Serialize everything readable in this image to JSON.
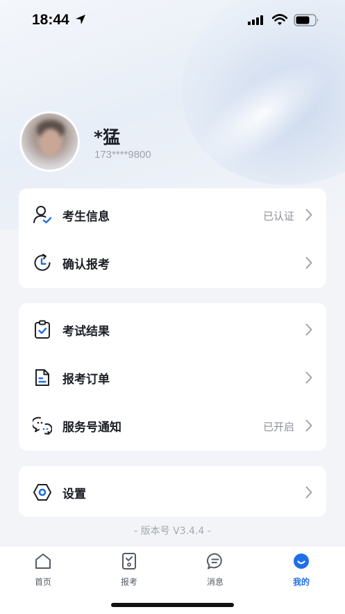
{
  "status_bar": {
    "time": "18:44",
    "icons": [
      "location-arrow-icon",
      "cellular-signal-icon",
      "wifi-icon",
      "battery-icon"
    ]
  },
  "profile": {
    "name": "*猛",
    "phone": "173****9800"
  },
  "groups": [
    {
      "items": [
        {
          "label": "考生信息",
          "status": "已认证",
          "icon": "user-check-icon"
        },
        {
          "label": "确认报考",
          "status": "",
          "icon": "clock-refresh-icon"
        }
      ]
    },
    {
      "items": [
        {
          "label": "考试结果",
          "status": "",
          "icon": "clipboard-check-icon"
        },
        {
          "label": "报考订单",
          "status": "",
          "icon": "document-icon"
        },
        {
          "label": "服务号通知",
          "status": "已开启",
          "icon": "chat-bubbles-icon"
        }
      ]
    },
    {
      "items": [
        {
          "label": "设置",
          "status": "",
          "icon": "settings-hexagon-icon"
        }
      ]
    }
  ],
  "version": "- 版本号 V3.4.4 -",
  "tabs": [
    {
      "label": "首页",
      "icon": "home-icon",
      "active": false
    },
    {
      "label": "报考",
      "icon": "exam-form-icon",
      "active": false
    },
    {
      "label": "消息",
      "icon": "message-icon",
      "active": false
    },
    {
      "label": "我的",
      "icon": "profile-smile-icon",
      "active": true
    }
  ],
  "colors": {
    "accent": "#1f6fe8",
    "text_primary": "#1c1f26",
    "text_secondary": "#8c9099",
    "page_background": "#f2f4f8"
  }
}
